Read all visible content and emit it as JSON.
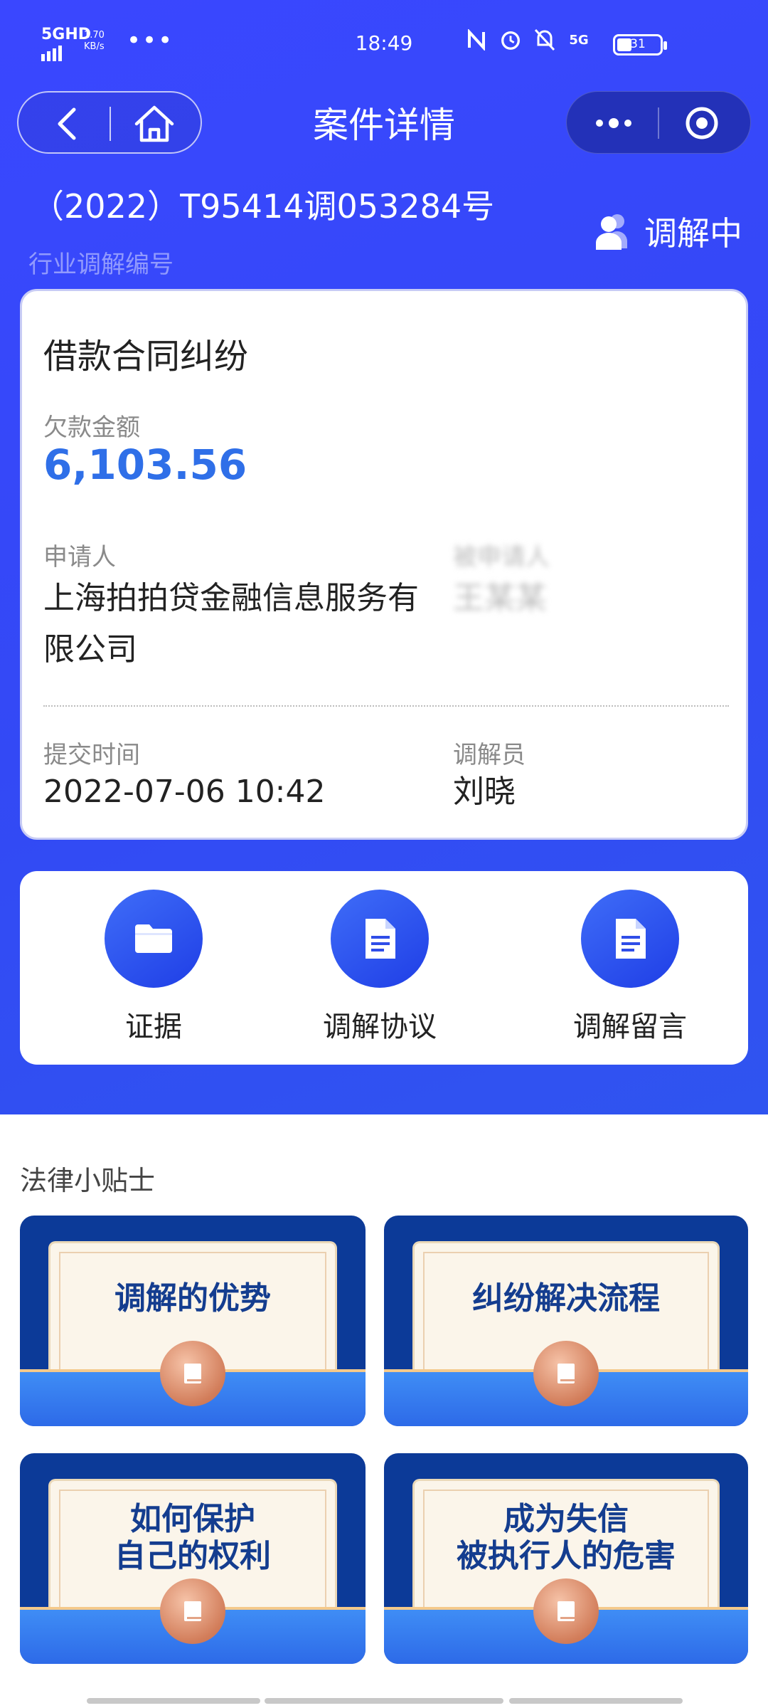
{
  "status_bar": {
    "network": "5GHD",
    "speed_value": "1.70",
    "speed_unit": "KB/s",
    "dots": "•••",
    "time": "18:49",
    "battery": "31"
  },
  "nav": {
    "title": "案件详情"
  },
  "case": {
    "number": "（2022）T95414调053284号",
    "number_label": "行业调解编号",
    "status": "调解中",
    "type": "借款合同纠纷",
    "amount_label": "欠款金额",
    "amount": "6,103.56",
    "applicant_label": "申请人",
    "applicant": "上海拍拍贷金融信息服务有限公司",
    "respondent_label": "被申请人",
    "respondent": "王某某",
    "submit_label": "提交时间",
    "submit_time": "2022-07-06 10:42",
    "mediator_label": "调解员",
    "mediator": "刘晓"
  },
  "actions": [
    {
      "label": "证据",
      "icon": "folder-icon"
    },
    {
      "label": "调解协议",
      "icon": "document-icon"
    },
    {
      "label": "调解留言",
      "icon": "document-icon"
    }
  ],
  "tips": {
    "title": "法律小贴士",
    "items": [
      {
        "text": "调解的优势"
      },
      {
        "text": "纠纷解决流程"
      },
      {
        "line1": "如何保护",
        "line2": "自己的权利"
      },
      {
        "line1": "成为失信",
        "line2": "被执行人的危害"
      }
    ]
  },
  "colors": {
    "primary": "#3a47ff",
    "amount": "#2f6fe8",
    "tip_bg": "#0c3a98"
  }
}
